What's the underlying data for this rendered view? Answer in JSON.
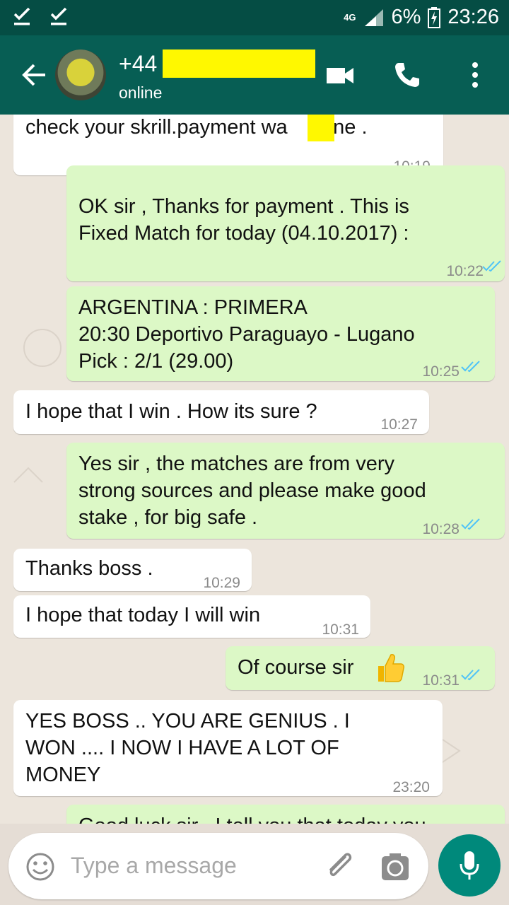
{
  "status_bar": {
    "network": "4G",
    "battery": "6%",
    "time": "23:26"
  },
  "header": {
    "contact_name": "+44",
    "presence": "online",
    "icons": [
      "back-arrow-icon",
      "avatar",
      "video-call-icon",
      "phone-icon",
      "more-vert-icon"
    ]
  },
  "messages": [
    {
      "dir": "in",
      "lines": [
        "check your skrill.payment wa    done ."
      ],
      "time": "10:19"
    },
    {
      "dir": "out",
      "lines": [
        "OK sir , Thanks for payment . This is",
        "Fixed Match for today (04.10.2017) :"
      ],
      "time": "10:22"
    },
    {
      "dir": "out",
      "lines": [
        "ARGENTINA : PRIMERA",
        "20:30 Deportivo Paraguayo - Lugano",
        "Pick : 2/1 (29.00)"
      ],
      "time": "10:25"
    },
    {
      "dir": "in",
      "lines": [
        "I hope that I win . How its sure ?"
      ],
      "time": "10:27"
    },
    {
      "dir": "out",
      "lines": [
        "Yes sir , the matches are from very",
        "strong sources and please make good",
        "stake , for big safe ."
      ],
      "time": "10:28"
    },
    {
      "dir": "in",
      "lines": [
        "Thanks boss ."
      ],
      "time": "10:29"
    },
    {
      "dir": "in",
      "lines": [
        "I hope that today I will win"
      ],
      "time": "10:31"
    },
    {
      "dir": "out",
      "lines": [
        "Of course sir"
      ],
      "time": "10:31",
      "emoji": "thumbs-up-icon"
    },
    {
      "dir": "in",
      "lines": [
        "YES BOSS .. YOU ARE GENIUS . I",
        "WON .... I NOW I HAVE A LOT OF",
        "MONEY"
      ],
      "time": "23:20"
    },
    {
      "dir": "out",
      "lines": [
        "Good luck sir , I tell you that today you"
      ],
      "time": ""
    }
  ],
  "composer": {
    "placeholder": "Type a message"
  },
  "colors": {
    "header": "#075e54",
    "status_bar": "#054d44",
    "outgoing_bubble": "#dcf8c6",
    "incoming_bubble": "#ffffff",
    "mic_button": "#00897b",
    "read_ticks": "#4fc3f7"
  }
}
